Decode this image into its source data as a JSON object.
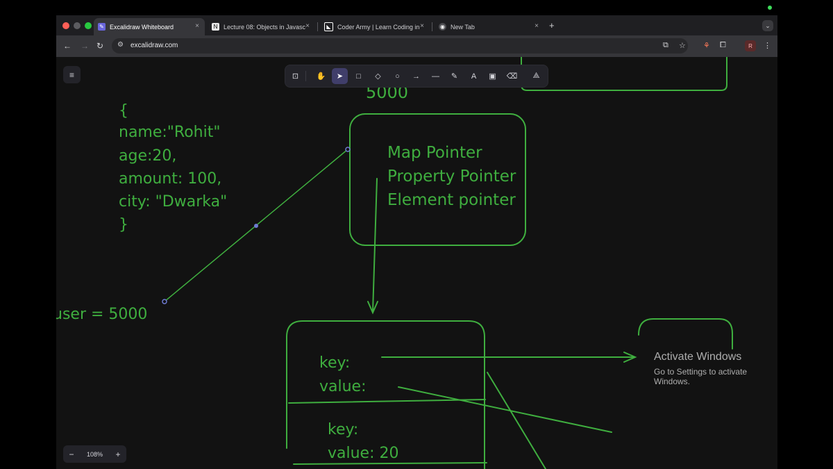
{
  "browser": {
    "tabs": [
      {
        "title": "Excalidraw Whiteboard",
        "icon": "excalidraw-icon",
        "active": true
      },
      {
        "title": "Lecture 08: Objects in Javasc",
        "icon": "notion-icon",
        "active": false
      },
      {
        "title": "Coder Army | Learn Coding in",
        "icon": "coder-army-icon",
        "active": false
      },
      {
        "title": "New Tab",
        "icon": "chrome-icon",
        "active": false
      }
    ],
    "close_glyph": "×",
    "new_tab_glyph": "+",
    "url": "excalidraw.com",
    "profile_initial": "R"
  },
  "excalidraw": {
    "zoom": "108%",
    "zoom_minus": "−",
    "zoom_plus": "+",
    "tools": [
      "lock",
      "hand",
      "selection",
      "rectangle",
      "diamond",
      "ellipse",
      "arrow",
      "line",
      "draw",
      "text",
      "image",
      "eraser",
      "more"
    ],
    "selected_tool": "selection"
  },
  "canvas_text": {
    "top_number": "5000",
    "object_lines": [
      "{",
      "name:\"Rohit\"",
      "age:20,",
      "amount: 100,",
      "city: \"Dwarka\"",
      "}"
    ],
    "user_label": "user = 5000",
    "pointer_lines": [
      "Map Pointer",
      "Property Pointer",
      "Element pointer"
    ],
    "prop_box_lines": [
      "key:",
      "value:",
      "key:",
      "value: 20"
    ]
  },
  "overlay": {
    "activate_title": "Activate Windows",
    "activate_sub": "Go to Settings to activate Windows."
  },
  "colors": {
    "stroke": "#3fae3f",
    "canvas": "#121212",
    "selected_tool": "#403e6a"
  }
}
